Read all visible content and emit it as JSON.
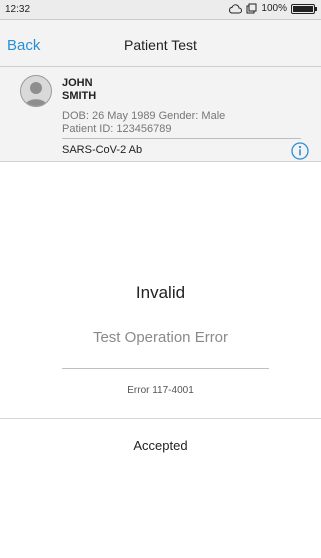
{
  "status_bar": {
    "time": "12:32",
    "battery_percent": "100%",
    "icons": [
      "cloud-icon",
      "sim-icon",
      "battery-icon"
    ]
  },
  "nav": {
    "back_label": "Back",
    "title": "Patient Test"
  },
  "patient": {
    "first_name": "JOHN",
    "last_name": "SMITH",
    "dob_gender": "DOB: 26 May 1989  Gender: Male",
    "patient_id": "Patient ID: 123456789",
    "test_name": "SARS-CoV-2 Ab"
  },
  "result": {
    "title": "Invalid",
    "subtitle": "Test Operation Error",
    "error_code": "Error 117-4001",
    "status": "Accepted"
  },
  "colors": {
    "accent": "#2a8fd6",
    "header_bg": "#f3f3f3"
  }
}
